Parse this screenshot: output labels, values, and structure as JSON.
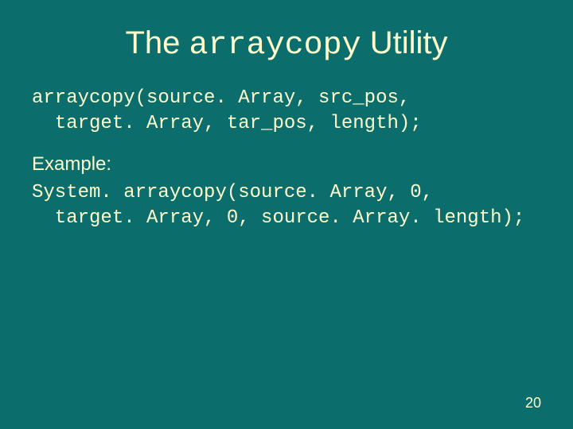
{
  "title": {
    "pre": "The ",
    "mono": "arraycopy",
    "post": " Utility"
  },
  "code1_line1": "arraycopy(source. Array, src_pos,",
  "code1_line2": "  target. Array, tar_pos, length);",
  "example_label": "Example:",
  "code2_line1": "System. arraycopy(source. Array, 0,",
  "code2_line2": "  target. Array, 0, source. Array. length);",
  "page_number": "20"
}
